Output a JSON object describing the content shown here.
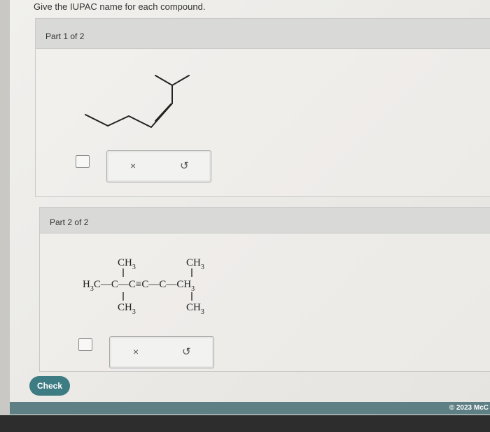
{
  "question": "Give the IUPAC name for each compound.",
  "part1": {
    "label": "Part 1 of 2",
    "x_label": "×",
    "undo_label": "↺"
  },
  "part2": {
    "label": "Part 2 of 2",
    "x_label": "×",
    "undo_label": "↺",
    "structure": {
      "top_left": "CH",
      "top_right": "CH",
      "middle_left": "H",
      "middle_chain": "C—C—C≡C—C—CH",
      "bottom_left": "CH",
      "bottom_right": "CH",
      "subscript": "3"
    }
  },
  "check_label": "Check",
  "footer": {
    "copyright": "© 2023 McC"
  }
}
